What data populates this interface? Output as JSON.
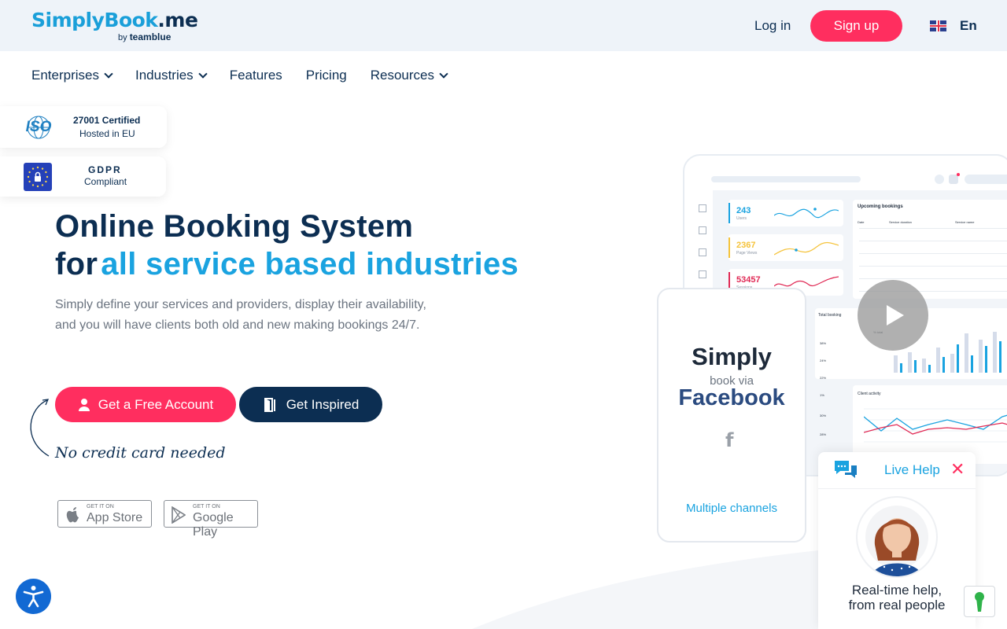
{
  "header": {
    "logo_main": "SimplyBook",
    "logo_tld": ".me",
    "logo_by": "by",
    "logo_partner": "teamblue",
    "login": "Log in",
    "signup": "Sign up",
    "language": "En"
  },
  "nav": {
    "items": [
      {
        "label": "Enterprises",
        "dropdown": true
      },
      {
        "label": "Industries",
        "dropdown": true
      },
      {
        "label": "Features",
        "dropdown": false
      },
      {
        "label": "Pricing",
        "dropdown": false
      },
      {
        "label": "Resources",
        "dropdown": true
      }
    ]
  },
  "badges": {
    "iso_logo": "ISO",
    "iso_title": "27001 Certified",
    "iso_sub": "Hosted in EU",
    "gdpr_title": "GDPR",
    "gdpr_sub": "Compliant"
  },
  "hero": {
    "title_line1": "Online Booking System",
    "title_line2_prefix": "for",
    "title_line2_highlight": "all service based industries",
    "description": "Simply define your services and providers, display their availability, and you will have clients both old and new making bookings 24/7.",
    "cta_primary": "Get a Free Account",
    "cta_secondary": "Get Inspired",
    "no_card": "No credit card needed"
  },
  "stores": {
    "apple_small": "GET IT ON",
    "apple_big": "App Store",
    "google_small": "GET IT ON",
    "google_big": "Google Play"
  },
  "dashboard": {
    "kpi1_value": "243",
    "kpi1_label": "Users",
    "kpi2_value": "2367",
    "kpi2_label": "Page Views",
    "kpi3_value": "53457",
    "kpi3_label": "Sessions",
    "upcoming_title": "Upcoming bookings",
    "upcoming_cols": [
      "Date",
      "Service duration",
      "Service name"
    ],
    "total_booking": "Total booking",
    "total_pct_header": "% total",
    "total_pcts": [
      "38%",
      "24%",
      "22%",
      "1%",
      "30%",
      "28%"
    ],
    "client_activity": "Client activity"
  },
  "phone": {
    "title": "Simply",
    "via": "book via",
    "brand": "Facebook",
    "brand_icon": "f",
    "footer": "Multiple channels"
  },
  "live_help": {
    "title": "Live Help",
    "close": "✕",
    "line1": "Real-time help,",
    "line2": "from real people"
  },
  "colors": {
    "brand_blue": "#1aa3e0",
    "navy": "#0c2e52",
    "accent_pink": "#ff2e5f",
    "topbar_bg": "#eef3f9"
  }
}
